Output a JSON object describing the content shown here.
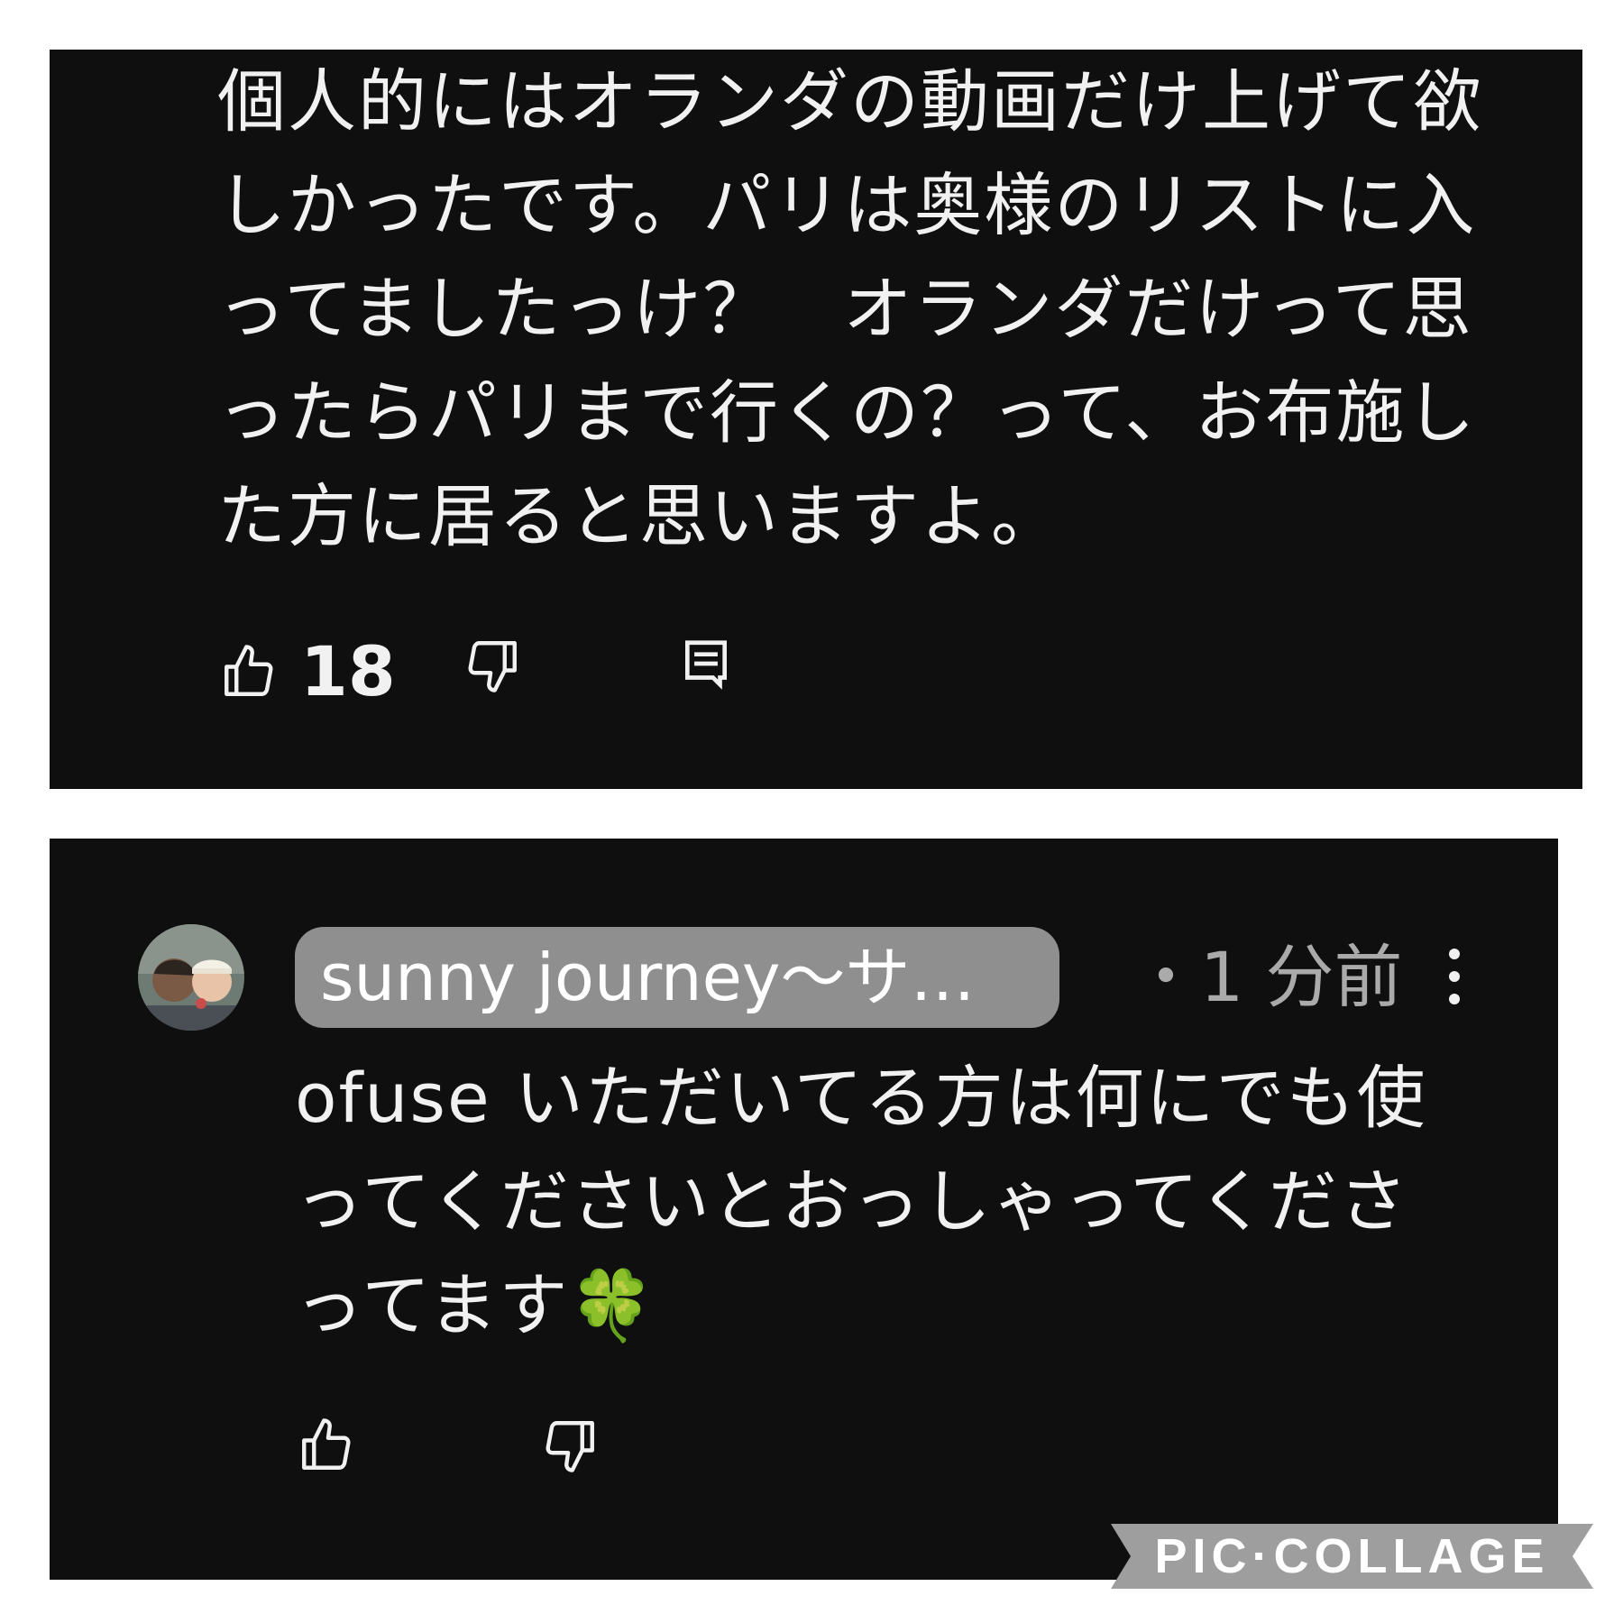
{
  "comments": [
    {
      "text": "個人的にはオランダの動画だけ上げて欲しかったです。パリは奥様のリストに入ってましたっけ？　オランダだけって思ったらパリまで行くの？って、お布施した方に居ると思いますよ。",
      "like_count": "18",
      "icons": [
        "thumbs-up-icon",
        "thumbs-down-icon",
        "reply-icon"
      ]
    },
    {
      "author": "sunny journey～サ…",
      "timestamp": "・1 分前",
      "text": "ofuse いただいてる方は何にでも使ってくださいとおっしゃってくださってます🍀",
      "icons": [
        "avatar",
        "more-vertical-icon",
        "thumbs-up-icon",
        "thumbs-down-icon"
      ]
    }
  ],
  "watermark": "PIC·COLLAGE",
  "colors": {
    "panel_bg": "#0f0f0f",
    "text": "#f1f1f1",
    "author_chip": "#8f8f8f",
    "timestamp": "#aaaaaa",
    "watermark_bg": "#9e9e9e"
  }
}
